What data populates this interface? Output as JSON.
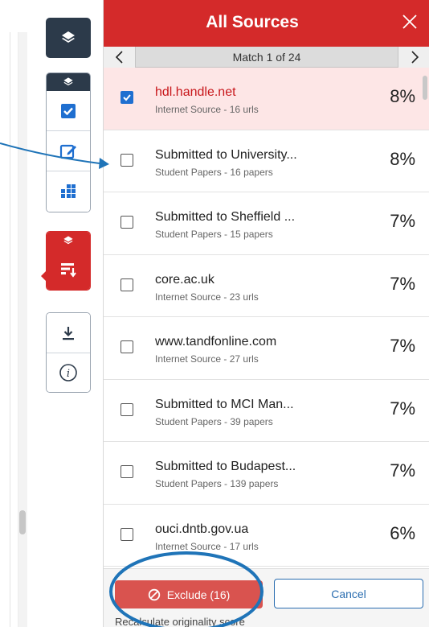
{
  "panel": {
    "title": "All Sources",
    "nav_text": "Match 1 of 24"
  },
  "sources": [
    {
      "title": "hdl.handle.net",
      "subtitle": "Internet Source - 16 urls",
      "percent": "8%",
      "checked": true
    },
    {
      "title": "Submitted to University...",
      "subtitle": "Student Papers - 16 papers",
      "percent": "8%",
      "checked": false
    },
    {
      "title": "Submitted to Sheffield ...",
      "subtitle": "Student Papers - 15 papers",
      "percent": "7%",
      "checked": false
    },
    {
      "title": "core.ac.uk",
      "subtitle": "Internet Source - 23 urls",
      "percent": "7%",
      "checked": false
    },
    {
      "title": "www.tandfonline.com",
      "subtitle": "Internet Source - 27 urls",
      "percent": "7%",
      "checked": false
    },
    {
      "title": "Submitted to MCI Man...",
      "subtitle": "Student Papers - 39 papers",
      "percent": "7%",
      "checked": false
    },
    {
      "title": "Submitted to Budapest...",
      "subtitle": "Student Papers - 139 papers",
      "percent": "7%",
      "checked": false
    },
    {
      "title": "ouci.dntb.gov.ua",
      "subtitle": "Internet Source - 17 urls",
      "percent": "6%",
      "checked": false
    }
  ],
  "footer": {
    "exclude_label": "Exclude (16)",
    "cancel_label": "Cancel",
    "recalc_label": "Recalculate originality score"
  },
  "icons": {
    "layers": "layers-icon",
    "checkbox": "checkbox-icon",
    "edit": "edit-icon",
    "grid": "grid-icon",
    "filter": "filter-sort-icon",
    "download": "download-icon",
    "info": "info-icon",
    "close": "close-icon",
    "prev": "chevron-left-icon",
    "next": "chevron-right-icon",
    "ban": "ban-icon"
  },
  "colors": {
    "brand_red": "#d42a2a",
    "dark_navy": "#2c3a4a",
    "accent_blue": "#1f6fd0",
    "selected_row": "#fde6e6",
    "annotation_blue": "#1f74b8"
  }
}
